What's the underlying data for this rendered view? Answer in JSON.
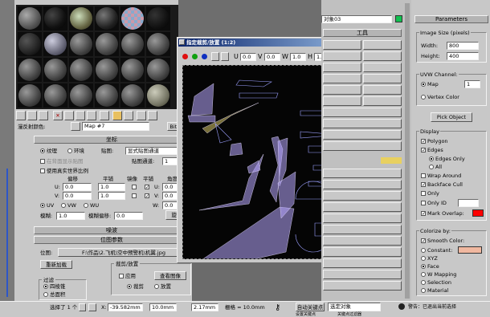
{
  "material_editor": {
    "map_label": "漫反射颜色:",
    "map_name": "Map #7",
    "map_type": "Bitmap",
    "rollout_coordinates": "坐标",
    "texture_radio": "纹理",
    "environ_radio": "环境",
    "mapping_label": "贴图:",
    "mapping_value": "显式贴图通道",
    "show_back_label": "在背面显示贴图",
    "map_channel_label": "贴图通道:",
    "map_channel_value": "1",
    "real_world_label": "使用真实世界比例",
    "offset_header": "偏移",
    "tiling_header": "平铺",
    "mirror_header": "镜像",
    "tile_header": "平铺",
    "angle_header": "角度",
    "u_label": "U:",
    "v_label": "V:",
    "w_label": "W:",
    "u_offset": "0.0",
    "v_offset": "0.0",
    "u_tiling": "1.0",
    "v_tiling": "1.0",
    "u_angle": "0.0",
    "v_angle": "0.0",
    "w_angle": "0.0",
    "uv_radio": "UV",
    "vw_radio": "VW",
    "wu_radio": "WU",
    "blur_label": "模糊:",
    "blur_value": "1.0",
    "blur_offset_label": "模糊偏移:",
    "blur_offset_value": "0.0",
    "rotate_button": "旋转",
    "rollout_noise": "噪波",
    "rollout_bitmap": "位图参数",
    "bitmap_label": "位图:",
    "bitmap_path": "F:\\作品\\2.飞机\\空中预警机\\机翼.jpg",
    "reload_button": "重新加载",
    "crop_group": "裁剪/放置",
    "apply_label": "应用",
    "view_image_button": "查看图像",
    "crop_radio": "裁剪",
    "place_radio": "放置",
    "filter_group": "过滤",
    "pyramidal_radio": "四棱锥",
    "summed_radio": "总面积"
  },
  "dialog": {
    "title": "指定裁剪/放置 (1:2)",
    "u_label": "U",
    "v_label": "V",
    "w_label": "W",
    "h_label": "H",
    "u_value": "0.0",
    "v_value": "0.0",
    "w_value": "1.0",
    "h_value": "1.0",
    "uv_label": "UV"
  },
  "command_panel": {
    "object_name": "对象03",
    "tools_rollout": "工具"
  },
  "parameters": {
    "title": "Parameters",
    "image_size_group": "Image Size (pixels)",
    "width_label": "Width:",
    "width_value": "800",
    "height_label": "Height:",
    "height_value": "400",
    "uv_channel_group": "UVW Channel:",
    "map_radio": "Map",
    "map_value": "1",
    "vertex_color_radio": "Vertex Color",
    "pick_object_button": "Pick Object",
    "display_group": "Display",
    "polygon_label": "Polygon",
    "edges_label": "Edges",
    "edges_only_label": "Edges Only",
    "all_label": "All",
    "wrap_around_label": "Wrap Around",
    "backface_cull_label": "Backface Cull",
    "only_label": "Only",
    "only_id_label": "Only ID",
    "mark_overlap_label": "Mark Overlap:",
    "colorize_group": "Colorize by:",
    "smooth_color_label": "Smooth Color:",
    "constant_label": "Constant:",
    "xyz_label": "XYZ",
    "face_label": "Face",
    "uvw_mapping_label": "W Mapping",
    "selection_label": "Selection",
    "material_label": "Material",
    "overlap_color": "#ff0000",
    "constant_color": "#f0b8a0"
  },
  "status_bar": {
    "selection_label": "选择了 1 个",
    "x_label": "X:",
    "x_value": "-39.582mm",
    "y_value": "10.0mm",
    "z_value": "2.17mm",
    "grid_label": "栅格 = 10.0mm",
    "autokey_label": "自动关键点",
    "selected_dropdown": "选定对象",
    "setkey_label": "设置关键点",
    "keyfilter_label": "关键点过滤器",
    "warning_text": "警告：已退出当前选择"
  }
}
